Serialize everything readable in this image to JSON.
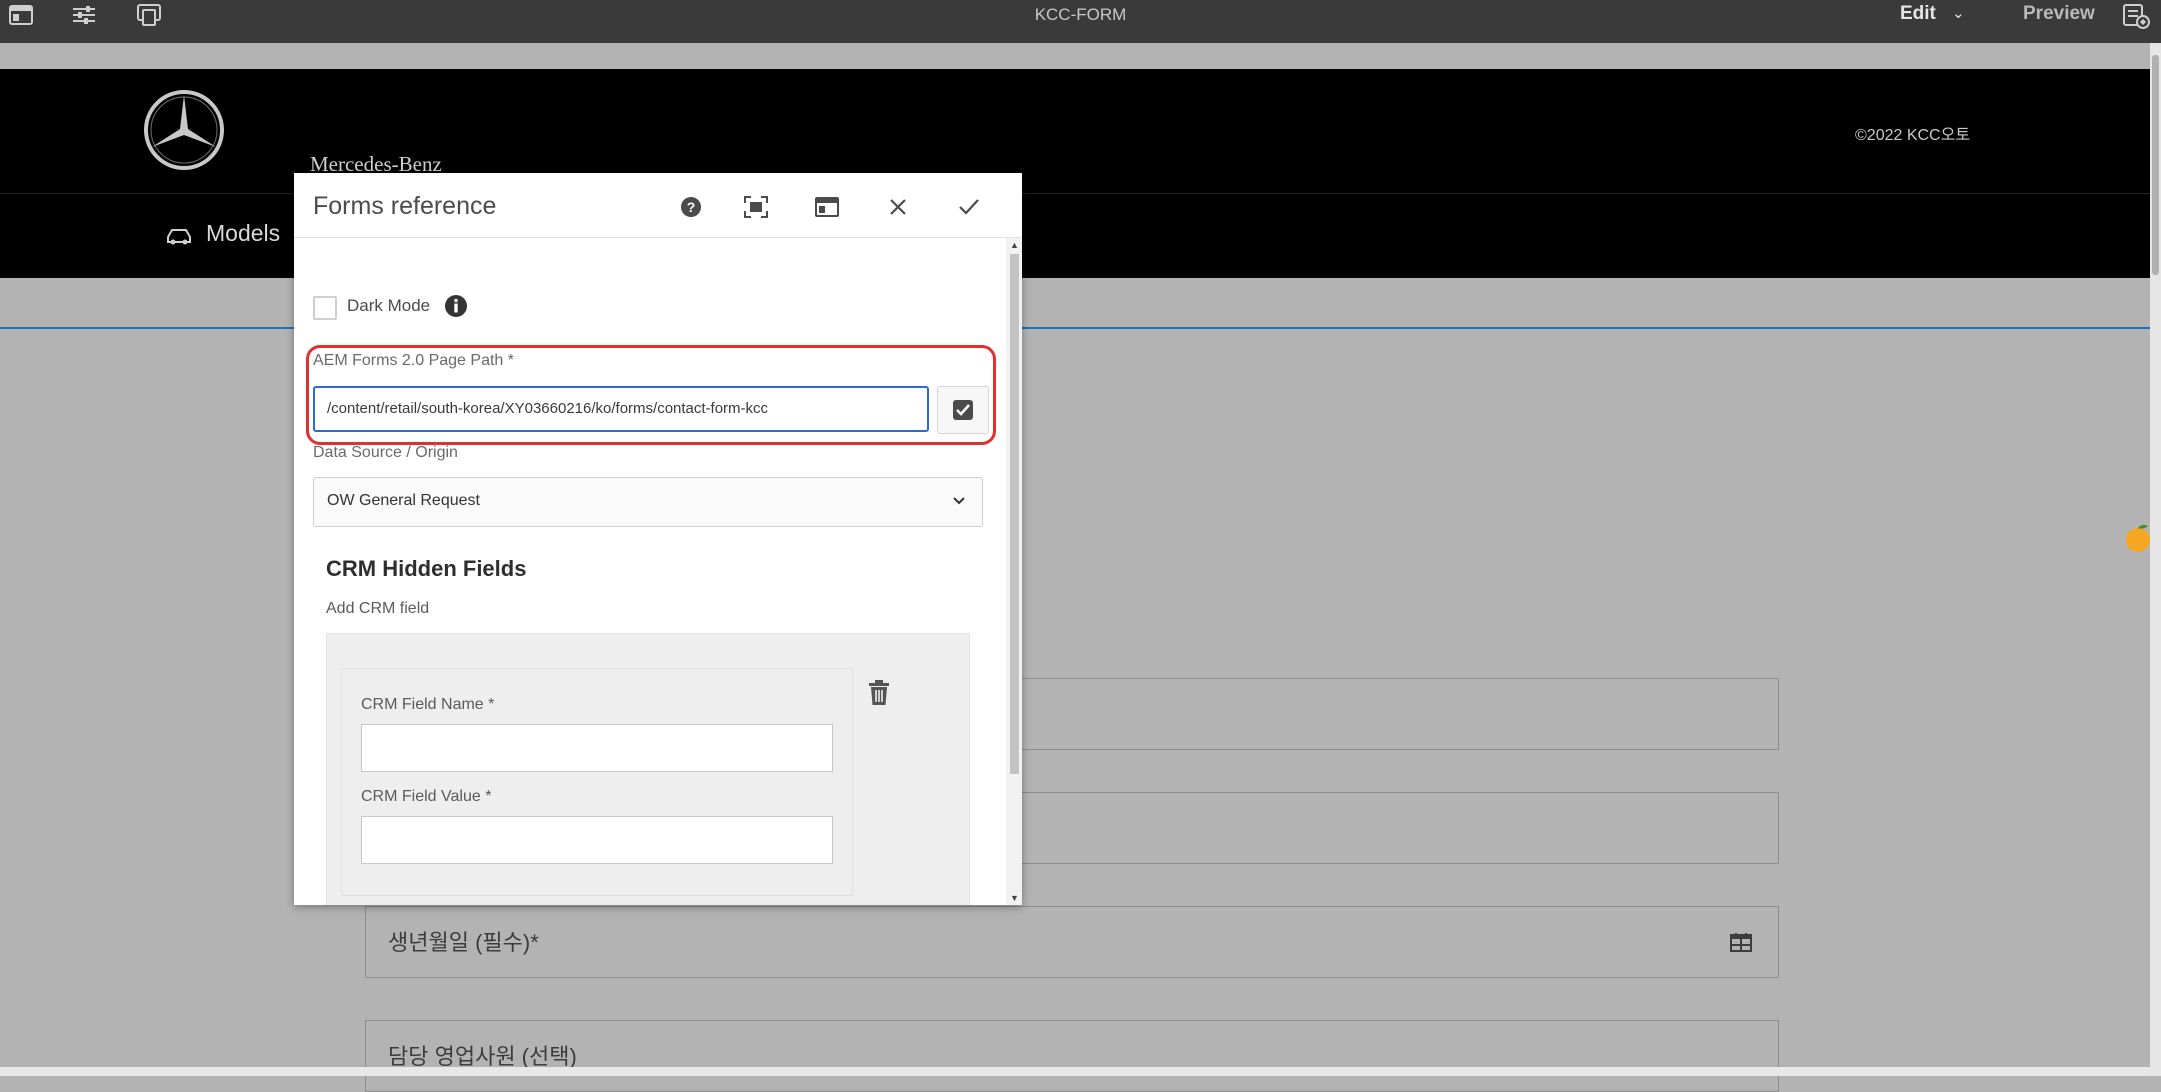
{
  "topbar": {
    "title": "KCC-FORM",
    "edit_label": "Edit",
    "preview_label": "Preview",
    "left_icons": [
      "page-info-icon",
      "properties-sliders-icon",
      "emulator-icon"
    ],
    "right_icon": "annotations-icon"
  },
  "site": {
    "brand": "Mercedes-Benz",
    "copyright": "©2022 KCC오토",
    "nav_models": "Models"
  },
  "page_fields": [
    {
      "text": ""
    },
    {
      "text": ""
    },
    {
      "text": "생년월일 (필수)*",
      "icon": "calendar-icon"
    },
    {
      "text": "담당 영업사원 (선택)"
    }
  ],
  "dialog": {
    "title": "Forms reference",
    "buttons": [
      "help-icon",
      "fullscreen-icon",
      "panel-icon",
      "close-icon",
      "confirm-check-icon"
    ],
    "dark_mode_label": "Dark Mode",
    "dark_mode_checked": false,
    "path_label": "AEM Forms 2.0 Page Path *",
    "path_value": "/content/retail/south-korea/XY03660216/ko/forms/contact-form-kcc",
    "data_source_label": "Data Source / Origin",
    "data_source_value": "OW General Request",
    "crm_title": "CRM Hidden Fields",
    "add_crm_label": "Add CRM field",
    "crm_field_name_label": "CRM Field Name *",
    "crm_field_name_value": "",
    "crm_field_value_label": "CRM Field Value *",
    "crm_field_value_value": ""
  },
  "colors": {
    "highlight_border": "#e03030",
    "input_focus": "#2b6ad6",
    "topbar_bg": "#3a3a3a",
    "header_bg": "#000000"
  }
}
